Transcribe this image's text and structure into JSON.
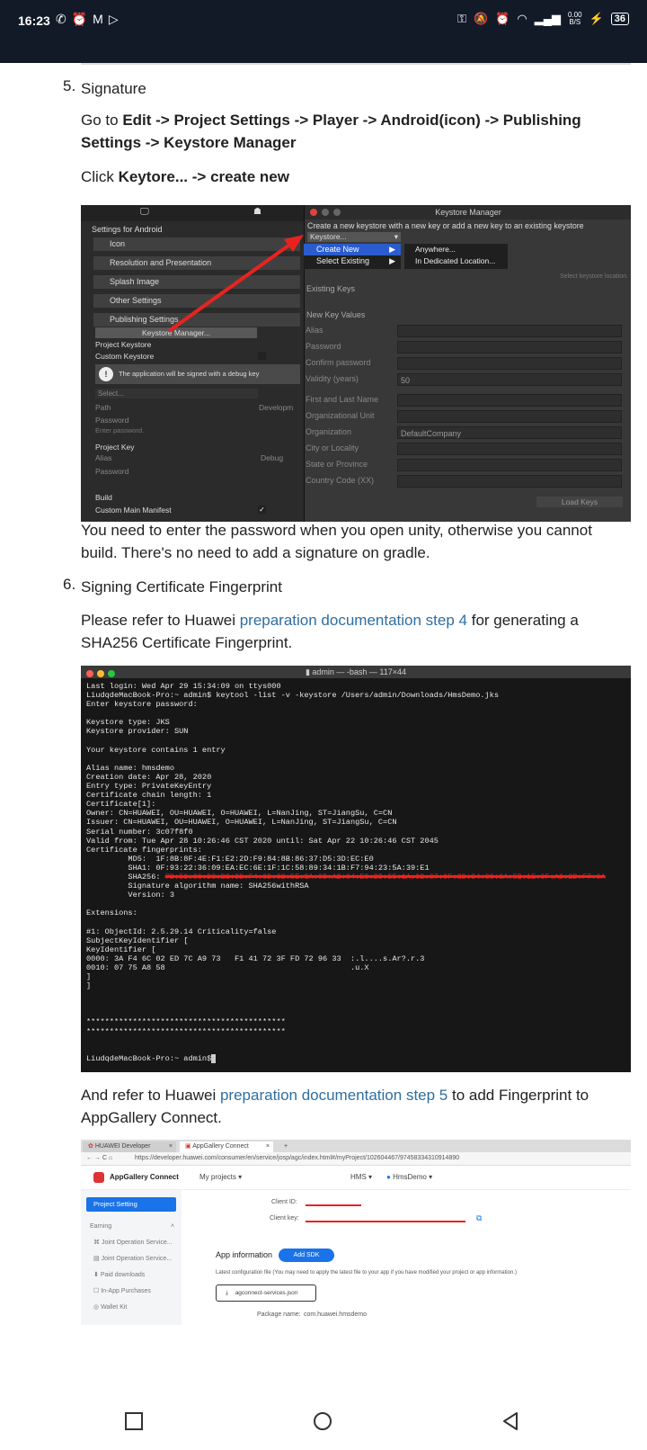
{
  "status_bar": {
    "time": "16:23",
    "left_icons": [
      "whatsapp-icon",
      "alarm-icon",
      "gmail-icon",
      "play-icon"
    ],
    "net_speed": "0.00",
    "net_unit": "B/S",
    "battery": "36"
  },
  "step5": {
    "number": "5.",
    "title": "Signature",
    "go_prefix": "Go to ",
    "go_path": "Edit -> Project Settings -> Player -> Android(icon) -> Publishing Settings -> Keystore Manager",
    "click_prefix": "Click ",
    "click_path": "Keytore... -> create new",
    "note": "You need to enter the password when you open unity, otherwise you cannot build. There's no need to add a signature on gradle."
  },
  "unity": {
    "settings_title": "Settings for Android",
    "items": [
      "Icon",
      "Resolution and Presentation",
      "Splash Image",
      "Other Settings",
      "Publishing Settings"
    ],
    "keystore_manager_button": "Keystore Manager...",
    "project_keystore": "Project Keystore",
    "custom_keystore": "Custom Keystore",
    "debug_notice": "The application will be signed with a debug key",
    "select": "Select...",
    "path": "Path",
    "password": "Password",
    "enter_password": "Enter password.",
    "project_key": "Project Key",
    "alias": "Alias",
    "key_password": "Password",
    "build": "Build",
    "custom_main_manifest": "Custom Main Manifest",
    "develop": "Developm",
    "debug": "Debug",
    "window_title": "Keystore Manager",
    "description": "Create a new keystore with a new key or add a new key to an existing keystore",
    "keystore_dropdown": "Keystore...",
    "menu": [
      "Create New",
      "Select Existing"
    ],
    "submenu": [
      "Anywhere...",
      "In Dedicated Location..."
    ],
    "select_location_hint": "Select keystore location.",
    "existing_keys": "Existing Keys",
    "new_key_values": "New Key Values",
    "fields": [
      "Alias",
      "Password",
      "Confirm password",
      "Validity (years)",
      "First and Last Name",
      "Organizational Unit",
      "Organization",
      "City or Locality",
      "State or Province",
      "Country Code (XX)"
    ],
    "validity_value": "50",
    "organization_value": "DefaultCompany",
    "load_keys": "Load Keys"
  },
  "step6": {
    "number": "6.",
    "title": "Signing Certificate Fingerprint",
    "refer_prefix": "Please refer to Huawei ",
    "refer_link": "preparation documentation step 4",
    "refer_suffix": " for generating a SHA256 Certificate Fingerprint.",
    "and_prefix": "And refer to Huawei ",
    "and_link": "preparation documentation step 5",
    "and_suffix": " to add Fingerprint to AppGallery Connect."
  },
  "terminal": {
    "title": "admin — -bash — 117×44",
    "lines_before": "Last login: Wed Apr 29 15:34:09 on ttys000\nLiudqdeMacBook-Pro:~ admin$ keytool -list -v -keystore /Users/admin/Downloads/HmsDemo.jks\nEnter keystore password:\n\nKeystore type: JKS\nKeystore provider: SUN\n\nYour keystore contains 1 entry\n\nAlias name: hmsdemo\nCreation date: Apr 28, 2020\nEntry type: PrivateKeyEntry\nCertificate chain length: 1\nCertificate[1]:\nOwner: CN=HUAWEI, OU=HUAWEI, O=HUAWEI, L=NanJing, ST=JiangSu, C=CN\nIssuer: CN=HUAWEI, OU=HUAWEI, O=HUAWEI, L=NanJing, ST=JiangSu, C=CN\nSerial number: 3c07f8f0\nValid from: Tue Apr 28 10:26:46 CST 2020 until: Sat Apr 22 10:26:46 CST 2045\nCertificate fingerprints:\n         MD5:  1F:8B:8F:4E:F1:E2:2D:F9:84:8B:86:37:D5:3D:EC:E0\n         SHA1: 0F:93:22:36:09:EA:EC:6E:1F:1C:58:89:34:1B:F7:94:23:5A:39:E1",
    "sha256_label": "         SHA256: ",
    "sha256_value": "7D:59:0C:D0:B2:0D:F4:0D:C2:5E:3A:0D:A2:C4:E9:DD:55:1A:0B:C7:0F:3D:84:CC:6A:5B:1E:0F:A9:2D:F7:0A",
    "lines_after": "         Signature algorithm name: SHA256withRSA\n         Version: 3\n\nExtensions:\n\n#1: ObjectId: 2.5.29.14 Criticality=false\nSubjectKeyIdentifier [\nKeyIdentifier [\n0000: 3A F4 6C 02 ED 7C A9 73   F1 41 72 3F FD 72 96 33  :.l....s.Ar?.r.3\n0010: 07 75 A8 58                                        .u.X\n]\n]\n\n\n\n*******************************************\n*******************************************\n\n\nLiudqdeMacBook-Pro:~ admin$"
  },
  "appgallery": {
    "tab1": "HUAWEI Developer",
    "tab2": "AppGallery Connect",
    "url": "https://developer.huawei.com/consumer/en/service/josp/agc/index.html#/myProject/102604467/97458334310914890",
    "brand": "AppGallery Connect",
    "my_projects": "My projects",
    "hms": "HMS",
    "project": "HmsDemo",
    "side_active": "Project Setting",
    "side_items": [
      "Earning",
      "Joint Operation Service...",
      "Joint Operation Service...",
      "Paid downloads",
      "In-App Purchases",
      "Wallet Kit"
    ],
    "client_id_label": "Client ID:",
    "client_key_label": "Client key:",
    "app_info": "App information",
    "add_sdk": "Add SDK",
    "config_note": "Latest configuration file (You may need to apply the latest file to your app if you have modified your project or app information.)",
    "json_file": "agconnect-services.json",
    "package_label": "Package name:",
    "package_value": "com.huawei.hmsdemo"
  }
}
